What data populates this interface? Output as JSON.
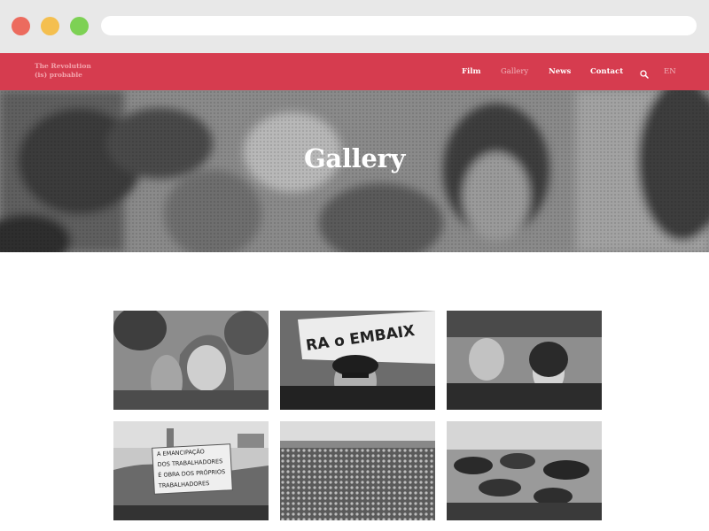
{
  "brand": {
    "line1": "The Revolution",
    "line2": "(is) probable"
  },
  "nav": {
    "items": [
      {
        "label": "Film",
        "active": false
      },
      {
        "label": "Gallery",
        "active": true
      },
      {
        "label": "News",
        "active": false
      },
      {
        "label": "Contact",
        "active": false
      }
    ],
    "search_icon": "search-icon",
    "language": "EN"
  },
  "hero": {
    "title": "Gallery"
  },
  "gallery": {
    "photos": [
      {
        "description": "woman-in-headscarf-shouting"
      },
      {
        "description": "bearded-man-with-glasses-in-crowd"
      },
      {
        "description": "woman-shouting-in-rally"
      },
      {
        "description": "protest-banner",
        "banner_text": [
          "A EMANCIPAÇÃO",
          "DOS TRABALHADORES",
          "É OBRA DOS PRÓPRIOS",
          "TRABALHADORES"
        ]
      },
      {
        "description": "large-crowd-rally"
      },
      {
        "description": "crowd-with-umbrellas"
      }
    ],
    "sign_text_2": "RA o EMBAIX"
  },
  "colors": {
    "brand_red": "#d63c4f",
    "chrome_gray": "#e8e8e8"
  }
}
